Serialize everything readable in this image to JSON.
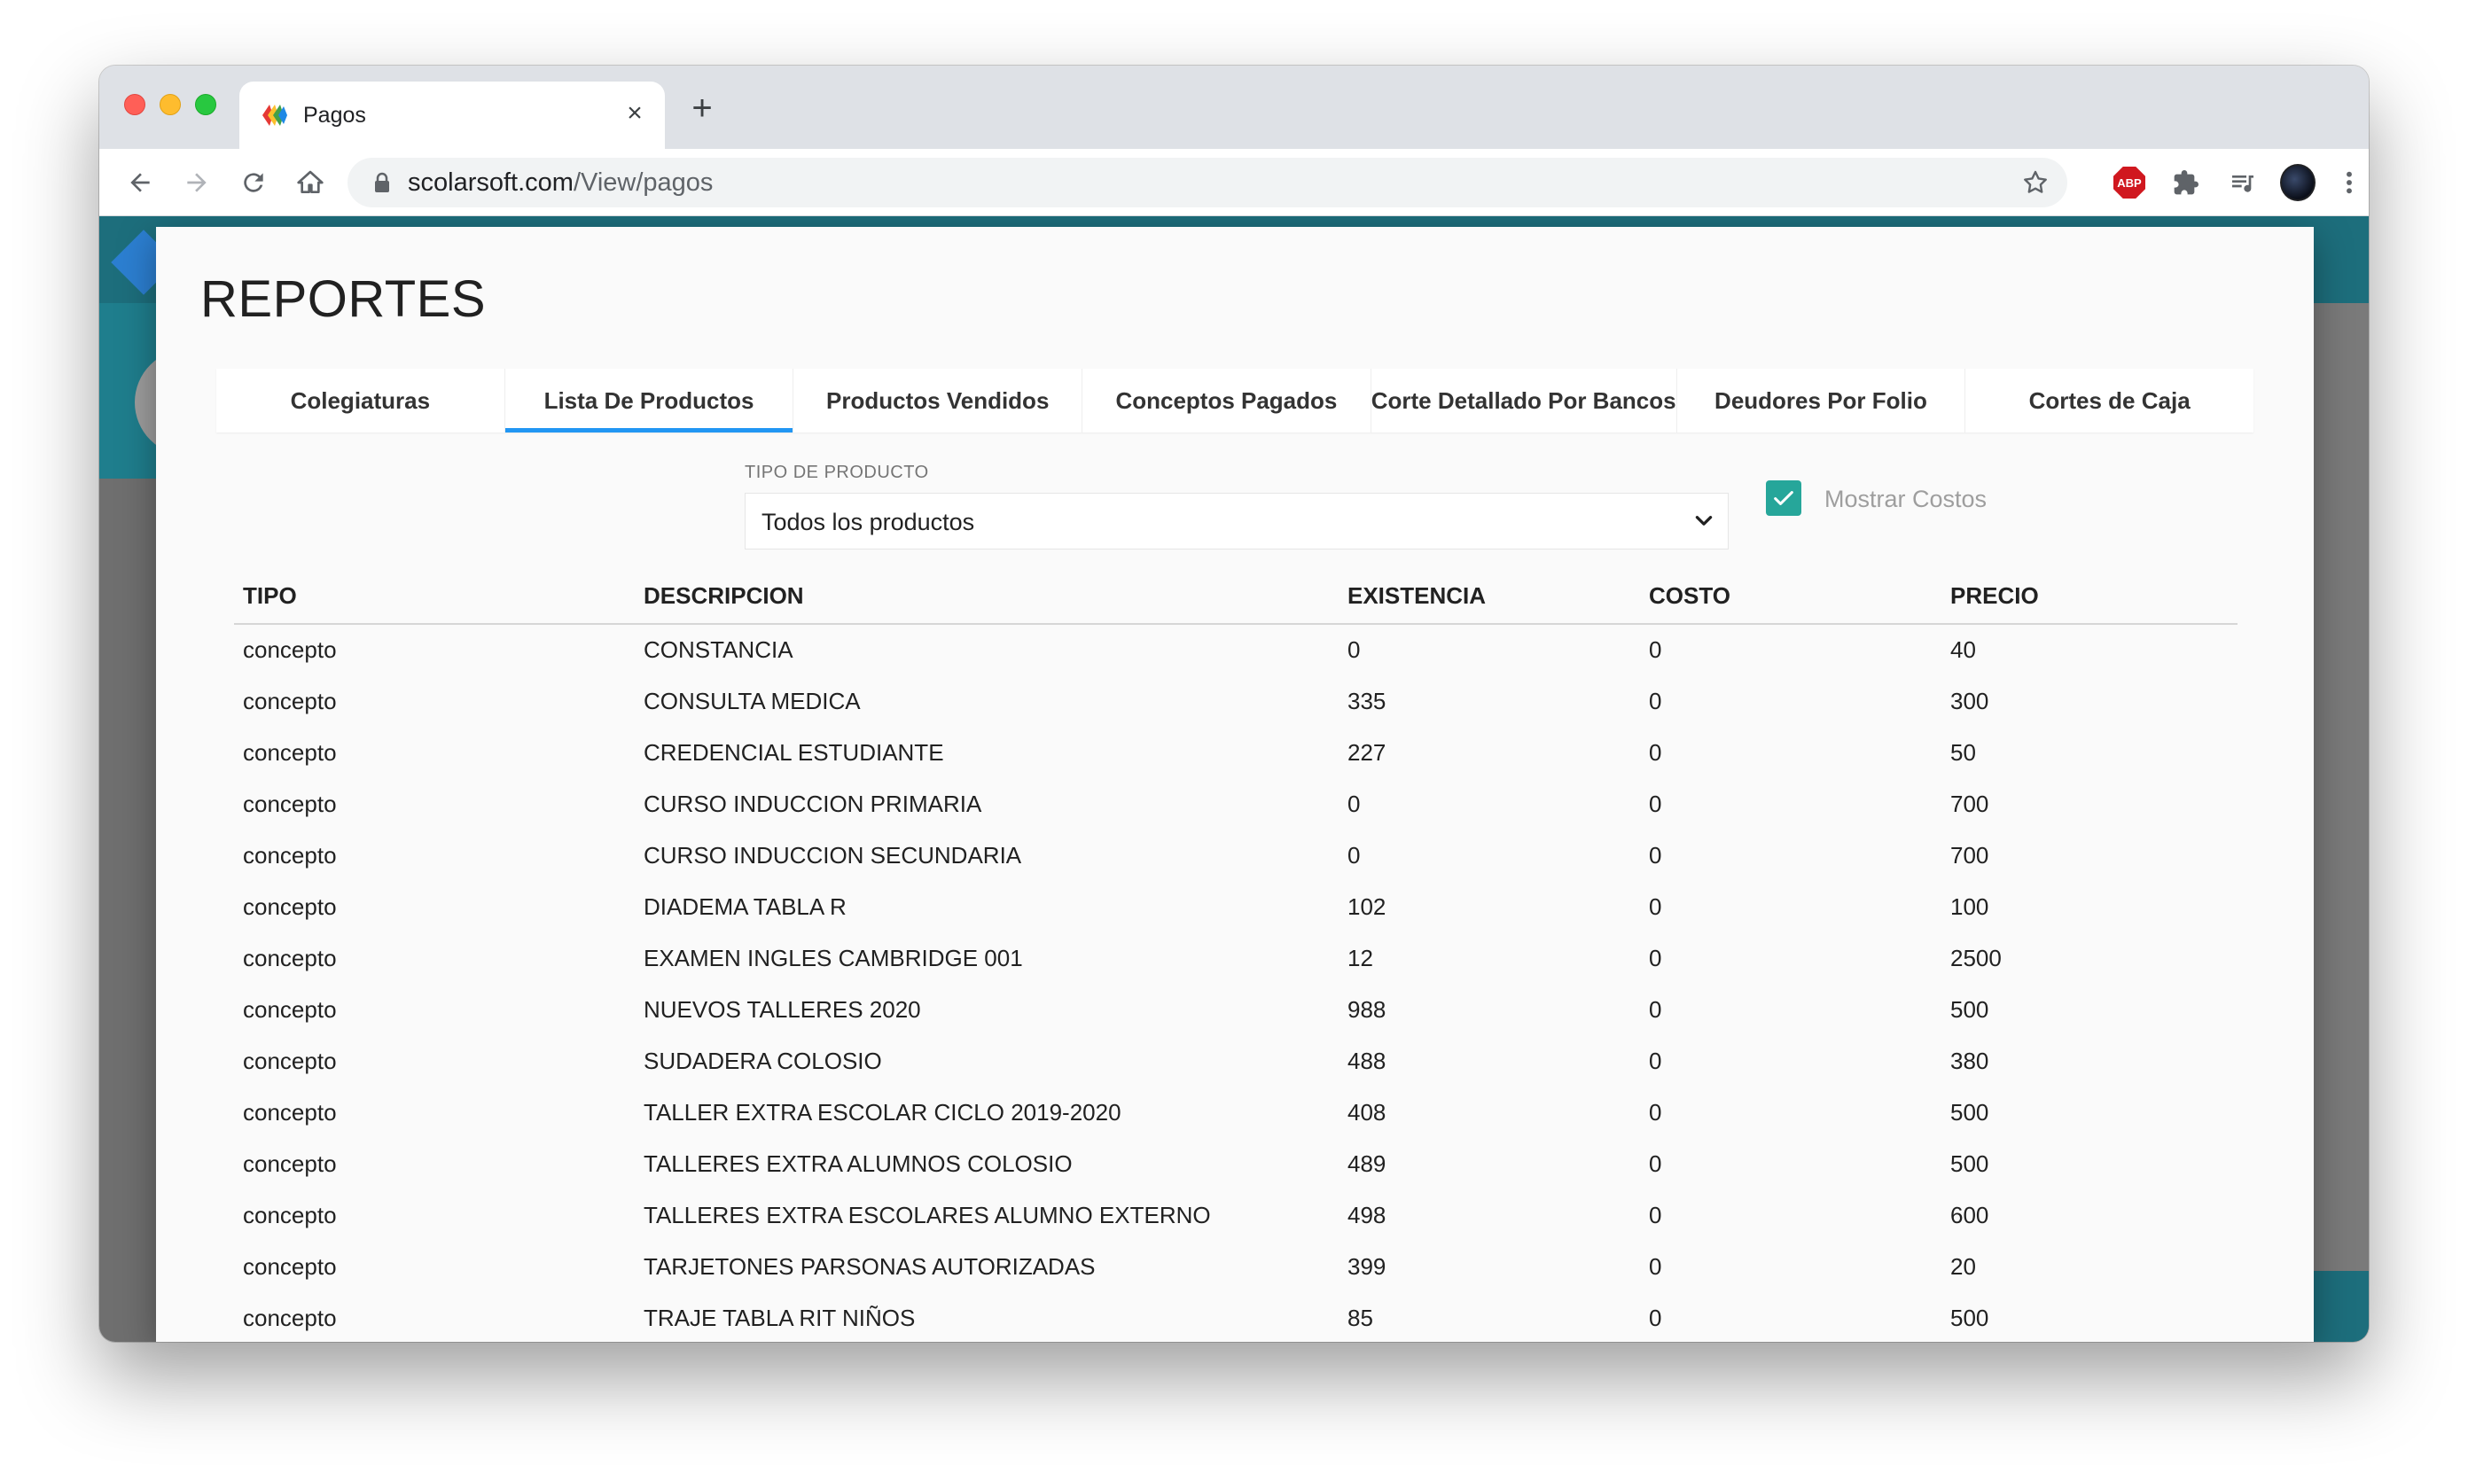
{
  "browser": {
    "tab_title": "Pagos",
    "url_host": "scolarsoft.com",
    "url_path": "/View/pagos",
    "extensions": {
      "adblock_badge": "ABP"
    }
  },
  "modal": {
    "title": "REPORTES",
    "tabs": [
      {
        "label": "Colegiaturas",
        "active": false
      },
      {
        "label": "Lista De Productos",
        "active": true
      },
      {
        "label": "Productos Vendidos",
        "active": false
      },
      {
        "label": "Conceptos Pagados",
        "active": false
      },
      {
        "label": "Corte Detallado Por Bancos",
        "active": false
      },
      {
        "label": "Deudores Por Folio",
        "active": false
      },
      {
        "label": "Cortes de Caja",
        "active": false
      }
    ],
    "filter": {
      "label": "TIPO DE PRODUCTO",
      "selected": "Todos los productos"
    },
    "show_costs": {
      "label": "Mostrar Costos",
      "checked": true
    },
    "table": {
      "headers": [
        "TIPO",
        "DESCRIPCION",
        "EXISTENCIA",
        "COSTO",
        "PRECIO"
      ],
      "rows": [
        [
          "concepto",
          "CONSTANCIA",
          "0",
          "0",
          "40"
        ],
        [
          "concepto",
          "CONSULTA MEDICA",
          "335",
          "0",
          "300"
        ],
        [
          "concepto",
          "CREDENCIAL ESTUDIANTE",
          "227",
          "0",
          "50"
        ],
        [
          "concepto",
          "CURSO INDUCCION PRIMARIA",
          "0",
          "0",
          "700"
        ],
        [
          "concepto",
          "CURSO INDUCCION SECUNDARIA",
          "0",
          "0",
          "700"
        ],
        [
          "concepto",
          "DIADEMA TABLA R",
          "102",
          "0",
          "100"
        ],
        [
          "concepto",
          "EXAMEN INGLES CAMBRIDGE 001",
          "12",
          "0",
          "2500"
        ],
        [
          "concepto",
          "NUEVOS TALLERES 2020",
          "988",
          "0",
          "500"
        ],
        [
          "concepto",
          "SUDADERA COLOSIO",
          "488",
          "0",
          "380"
        ],
        [
          "concepto",
          "TALLER EXTRA ESCOLAR CICLO 2019-2020",
          "408",
          "0",
          "500"
        ],
        [
          "concepto",
          "TALLERES EXTRA ALUMNOS COLOSIO",
          "489",
          "0",
          "500"
        ],
        [
          "concepto",
          "TALLERES EXTRA ESCOLARES ALUMNO EXTERNO",
          "498",
          "0",
          "600"
        ],
        [
          "concepto",
          "TARJETONES PARSONAS AUTORIZADAS",
          "399",
          "0",
          "20"
        ],
        [
          "concepto",
          "TRAJE TABLA RIT NIÑOS",
          "85",
          "0",
          "500"
        ]
      ]
    }
  },
  "colors": {
    "accent_tab": "#2196f3",
    "checkbox": "#26a69a",
    "app_header": "#1d6e7c"
  }
}
